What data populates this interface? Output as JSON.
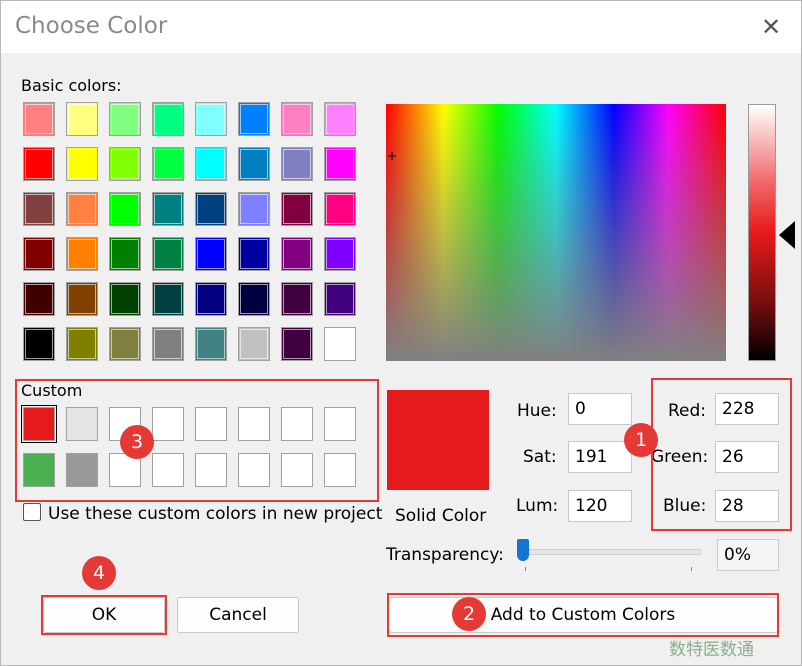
{
  "title": "Choose Color",
  "close_glyph": "✕",
  "basic_colors_label": "Basic colors:",
  "basic_colors": [
    [
      "#ff8080",
      "#ffff80",
      "#80ff80",
      "#00ff80",
      "#80ffff",
      "#0080ff",
      "#ff80c0",
      "#ff80ff"
    ],
    [
      "#ff0000",
      "#ffff00",
      "#80ff00",
      "#00ff40",
      "#00ffff",
      "#0080c0",
      "#8080c0",
      "#ff00ff"
    ],
    [
      "#804040",
      "#ff8040",
      "#00ff00",
      "#008080",
      "#004080",
      "#8080ff",
      "#800040",
      "#ff0080"
    ],
    [
      "#800000",
      "#ff8000",
      "#008000",
      "#008040",
      "#0000ff",
      "#0000a0",
      "#800080",
      "#8000ff"
    ],
    [
      "#400000",
      "#804000",
      "#004000",
      "#004040",
      "#000080",
      "#000040",
      "#400040",
      "#400080"
    ],
    [
      "#000000",
      "#808000",
      "#808040",
      "#808080",
      "#408080",
      "#c0c0c0",
      "#400040",
      "#ffffff"
    ]
  ],
  "custom_label": "Custom",
  "custom_colors": [
    [
      "#e41a1c",
      "#e4e4e4",
      "#ffffff",
      "#ffffff",
      "#ffffff",
      "#ffffff",
      "#ffffff",
      "#ffffff"
    ],
    [
      "#4caf50",
      "#999999",
      "#ffffff",
      "#ffffff",
      "#ffffff",
      "#ffffff",
      "#ffffff",
      "#ffffff"
    ]
  ],
  "use_custom_label": "Use these custom colors in new project",
  "solid_color_label": "Solid Color",
  "solid_color": "#e41a1c",
  "hue_label": "Hue:",
  "hue_value": "0",
  "sat_label": "Sat:",
  "sat_value": "191",
  "lum_label": "Lum:",
  "lum_value": "120",
  "red_label": "Red:",
  "red_value": "228",
  "green_label": "Green:",
  "green_value": "26",
  "blue_label": "Blue:",
  "blue_value": "28",
  "transparency_label": "Transparency:",
  "transparency_value": "0%",
  "transparency_level": 0,
  "ok_label": "OK",
  "cancel_label": "Cancel",
  "add_custom_label": "Add to Custom Colors",
  "badges": [
    "1",
    "2",
    "3",
    "4"
  ],
  "highlight_color": "#e53935",
  "watermark": "数特医数通"
}
